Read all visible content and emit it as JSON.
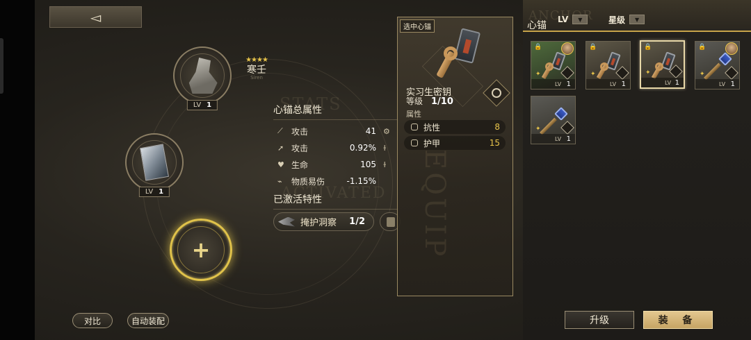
{
  "nav": {
    "back_glyph": "◅"
  },
  "character": {
    "stars": "★★★★",
    "name": "寒壬",
    "name_en": "Siren"
  },
  "slots": [
    {
      "lv_label": "LV",
      "lv": "1",
      "icon": "statue-portrait"
    },
    {
      "lv_label": "LV",
      "lv": "1",
      "icon": "card-portrait"
    },
    {
      "icon": "plus-icon",
      "glyph": "+"
    }
  ],
  "background_text": {
    "stats": "STATS",
    "activated": "ACTIVATED",
    "equip": "EQUIP",
    "anchor": "ANCHOR"
  },
  "stats_section": {
    "title": "心锚总属性",
    "rows": [
      {
        "icon": "sword-icon",
        "label": "攻击",
        "value": "41"
      },
      {
        "icon": "arrow-icon",
        "label": "攻击",
        "value": "0.92%"
      },
      {
        "icon": "heart-icon",
        "label": "生命",
        "value": "105"
      },
      {
        "icon": "vulnerability-icon",
        "label": "物质易伤",
        "value": "-1.15%"
      }
    ]
  },
  "traits_section": {
    "title": "已激活特性",
    "trait": {
      "name": "掩护洞察",
      "count": "1/2"
    }
  },
  "selected_panel": {
    "tag": "选中心锚",
    "item_name": "实习生密钥",
    "level_label": "等级",
    "level_value": "1/10",
    "props_title": "属性",
    "props": [
      {
        "icon": "resistance-icon",
        "name": "抗性",
        "value": "8"
      },
      {
        "icon": "armor-icon",
        "name": "护甲",
        "value": "15"
      }
    ]
  },
  "inventory": {
    "title": "心锚",
    "sort_dropdown": {
      "label": "LV",
      "arrow": "▼"
    },
    "filter_dropdown": {
      "label": "星级",
      "arrow": "▼"
    },
    "cards": [
      {
        "style": "green",
        "lock": "🔒",
        "lv_label": "LV",
        "lv": "1",
        "avatar": true,
        "key": "key"
      },
      {
        "style": "gray",
        "lock": "🔒",
        "lv_label": "LV",
        "lv": "1",
        "avatar": false,
        "key": "key"
      },
      {
        "style": "gray",
        "lock": "🔒",
        "lv_label": "LV",
        "lv": "1",
        "avatar": false,
        "key": "key",
        "selected": true
      },
      {
        "style": "blue",
        "lock": "🔒",
        "lv_label": "LV",
        "lv": "1",
        "avatar": true,
        "key": "scepter"
      },
      {
        "style": "blue",
        "lock": "",
        "lv_label": "LV",
        "lv": "1",
        "avatar": false,
        "key": "scepter"
      }
    ]
  },
  "buttons": {
    "compare": "对比",
    "auto_equip": "自动装配",
    "upgrade": "升级",
    "equip": "装 备"
  },
  "colors": {
    "accent_gold": "#e8c44a",
    "equip_button": "#d6b87a"
  }
}
